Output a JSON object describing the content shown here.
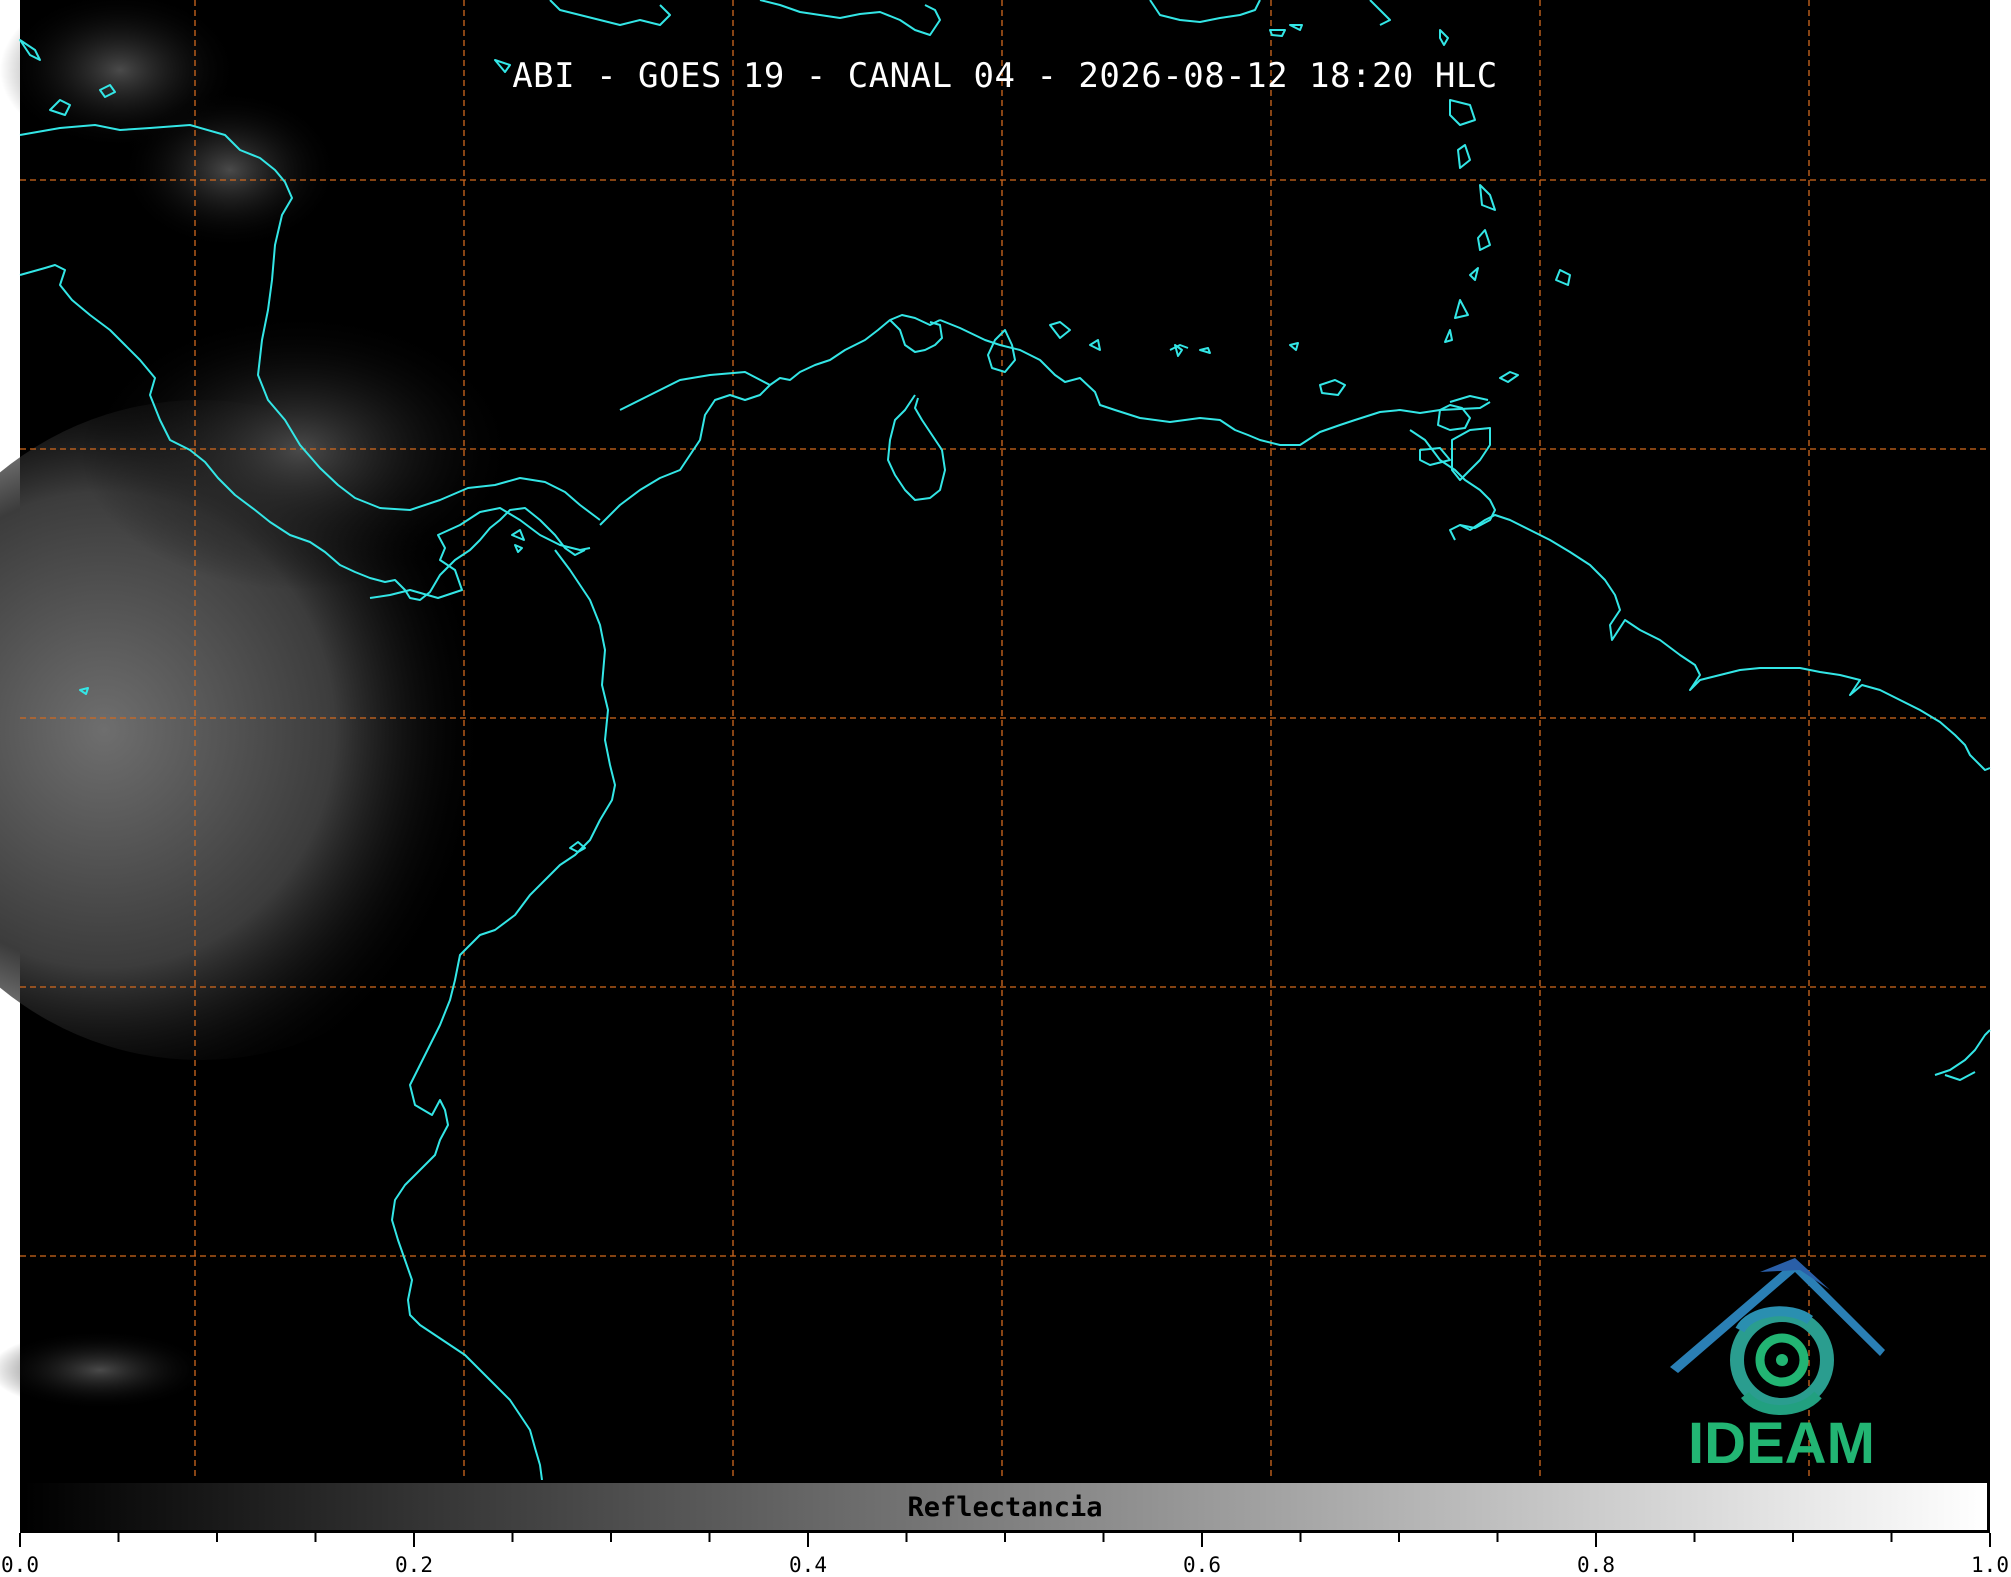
{
  "title": "ABI - GOES 19 - CANAL 04 - 2026-08-12 18:20 HLC",
  "logo": {
    "text": "IDEAM",
    "icon": "ideam-logo-icon"
  },
  "colorbar": {
    "label": "Reflectancia",
    "ticks": [
      "0.0",
      "0.2",
      "0.4",
      "0.6",
      "0.8",
      "1.0"
    ],
    "min": 0.0,
    "max": 1.0
  },
  "colors": {
    "coastline": "#33e6e6",
    "grid": "#d2691e",
    "background": "#000000",
    "logo_green": "#22b573",
    "logo_blue": "#2a6fb0"
  }
}
